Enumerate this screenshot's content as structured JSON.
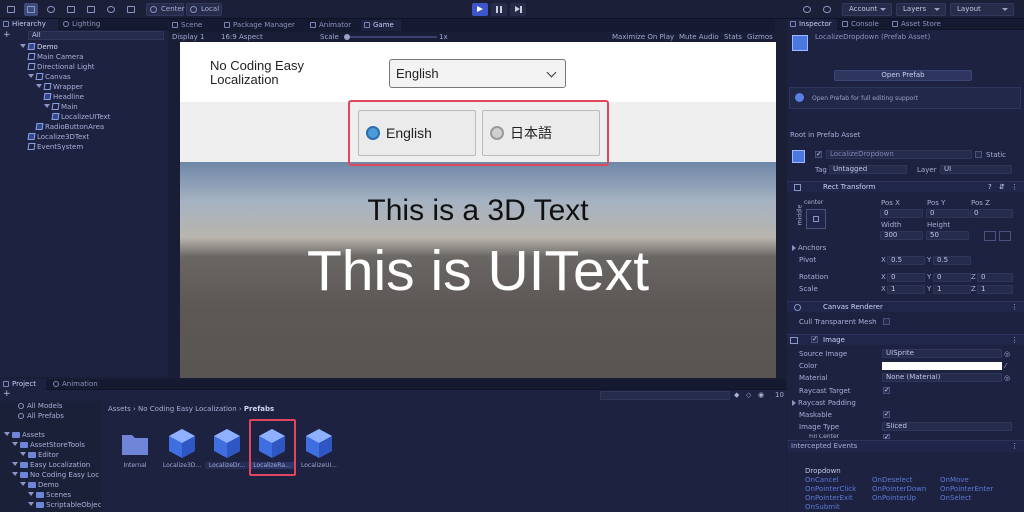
{
  "toolbar": {
    "pivot_center": "Center",
    "pivot_local": "Local",
    "account": "Account",
    "layers": "Layers",
    "layout": "Layout"
  },
  "hierarchy": {
    "tabs": [
      "Hierarchy",
      "Lighting"
    ],
    "search_placeholder": "All",
    "items": [
      {
        "label": "Demo",
        "depth": 0,
        "kind": "scene"
      },
      {
        "label": "Main Camera",
        "depth": 1,
        "kind": "object"
      },
      {
        "label": "Directional Light",
        "depth": 1,
        "kind": "object"
      },
      {
        "label": "Canvas",
        "depth": 1,
        "kind": "object"
      },
      {
        "label": "Wrapper",
        "depth": 2,
        "kind": "object"
      },
      {
        "label": "Headline",
        "depth": 3,
        "kind": "prefab"
      },
      {
        "label": "Main",
        "depth": 3,
        "kind": "object"
      },
      {
        "label": "LocalizeUIText",
        "depth": 4,
        "kind": "prefab"
      },
      {
        "label": "RadioButtonArea",
        "depth": 2,
        "kind": "prefab"
      },
      {
        "label": "Localize3DText",
        "depth": 1,
        "kind": "prefab"
      },
      {
        "label": "EventSystem",
        "depth": 1,
        "kind": "object"
      }
    ]
  },
  "scene_tabs": [
    "Scene",
    "Package Manager",
    "Animator",
    "Game"
  ],
  "gamebar": {
    "display": "Display 1",
    "aspect": "16:9 Aspect",
    "scale_label": "Scale",
    "scale_value": "1x",
    "options": [
      "Maximize On Play",
      "Mute Audio",
      "Stats",
      "Gizmos"
    ]
  },
  "game": {
    "headline_line1": "No Coding Easy",
    "headline_line2": "Localization",
    "dropdown_value": "English",
    "radio_options": [
      {
        "label": "English",
        "selected": true
      },
      {
        "label": "日本語",
        "selected": false
      }
    ],
    "text3d": "This is a 3D Text",
    "uitext": "This is UIText"
  },
  "inspector": {
    "tabs": [
      "Inspector",
      "Console",
      "Asset Store"
    ],
    "title": "LocalizeDropdown (Prefab Asset)",
    "open_prefab": "Open Prefab",
    "info": "Open Prefab for full editing support",
    "root_label": "Root in Prefab Asset",
    "object_name": "LocalizeDropdown",
    "static": "Static",
    "tag_label": "Tag",
    "tag_value": "Untagged",
    "layer_label": "Layer",
    "layer_value": "UI",
    "rect_transform": {
      "title": "Rect Transform",
      "anchor_h": "center",
      "anchor_v": "middle",
      "pos_headers": [
        "Pos X",
        "Pos Y",
        "Pos Z"
      ],
      "pos_values": [
        "0",
        "0",
        "0"
      ],
      "width_label": "Width",
      "height_label": "Height",
      "width": "300",
      "height": "50",
      "anchors": "Anchors",
      "pivot": "Pivot",
      "pivot_x": "0.5",
      "pivot_y": "0.5",
      "rotation": "Rotation",
      "rotation_values": [
        "0",
        "0",
        "0"
      ],
      "scale": "Scale",
      "scale_values": [
        "1",
        "1",
        "1"
      ],
      "axis_x": "X",
      "axis_y": "Y",
      "axis_z": "Z"
    },
    "canvas_renderer": {
      "title": "Canvas Renderer",
      "cull": "Cull Transparent Mesh"
    },
    "image": {
      "title": "Image",
      "source_label": "Source Image",
      "source_value": "UISprite",
      "color_label": "Color",
      "material_label": "Material",
      "material_value": "None (Material)",
      "raycast_target": "Raycast Target",
      "raycast_padding": "Raycast Padding",
      "maskable": "Maskable",
      "image_type_label": "Image Type",
      "image_type_value": "Sliced",
      "fill_center": "Fill Center"
    },
    "intercepted": {
      "title": "Intercepted Events",
      "subtitle": "Dropdown",
      "events": [
        "OnCancel",
        "OnDeselect",
        "OnMove",
        "OnPointerClick",
        "OnPointerDown",
        "OnPointerEnter",
        "OnPointerExit",
        "OnPointerUp",
        "OnSelect",
        "OnSubmit"
      ]
    }
  },
  "project": {
    "tabs": [
      "Project",
      "Animation"
    ],
    "favorites": [
      "All Models",
      "All Prefabs"
    ],
    "tree": [
      {
        "label": "Assets",
        "depth": 0
      },
      {
        "label": "AssetStoreTools",
        "depth": 1
      },
      {
        "label": "Editor",
        "depth": 2
      },
      {
        "label": "Easy Localization",
        "depth": 1
      },
      {
        "label": "No Coding Easy Loc",
        "depth": 1
      },
      {
        "label": "Demo",
        "depth": 2
      },
      {
        "label": "Scenes",
        "depth": 3
      },
      {
        "label": "ScriptableObjec",
        "depth": 3
      }
    ],
    "breadcrumb": [
      "Assets",
      "No Coding Easy Localization",
      "Prefabs"
    ],
    "item_count": "10",
    "assets": [
      {
        "label": "Internal",
        "kind": "folder"
      },
      {
        "label": "Localize3D...",
        "kind": "prefab"
      },
      {
        "label": "LocalizeDr...",
        "kind": "prefab"
      },
      {
        "label": "LocalizeRa...",
        "kind": "prefab"
      },
      {
        "label": "LocalizeUI...",
        "kind": "prefab"
      }
    ]
  },
  "colors": {
    "accent_highlight": "#e0465e",
    "play_active": "#3d55c8",
    "prefab_blue": "#4a78e0"
  }
}
